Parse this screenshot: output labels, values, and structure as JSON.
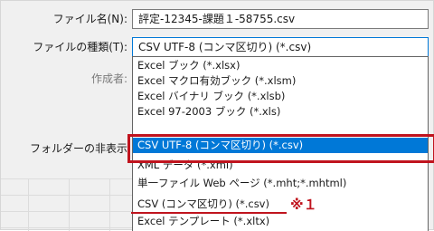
{
  "labels": {
    "filename": "ファイル名(N):",
    "filetype": "ファイルの種類(T):",
    "author": "作成者:",
    "hide_folders": "フォルダーの非表示"
  },
  "filename_value": "評定-12345-課題１-58755.csv",
  "filetype_value": "CSV UTF-8 (コンマ区切り) (*.csv)",
  "dropdown": {
    "options": [
      "Excel ブック (*.xlsx)",
      "Excel マクロ有効ブック (*.xlsm)",
      "Excel バイナリ ブック (*.xlsb)",
      "Excel 97-2003 ブック (*.xls)",
      "CSV UTF-8 (コンマ区切り) (*.csv)",
      "XML データ (*.xml)",
      "単一ファイル Web ページ (*.mht;*.mhtml)",
      "CSV (コンマ区切り) (*.csv)",
      "Excel テンプレート (*.xltx)"
    ],
    "selected_index": 4
  },
  "annotation": {
    "note": "※１"
  },
  "colors": {
    "selection": "#0078d7",
    "annotation_red": "#c0141e"
  }
}
